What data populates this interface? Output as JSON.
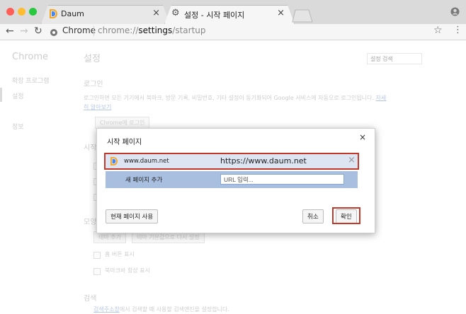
{
  "browser": {
    "tabs": [
      {
        "title": "Daum"
      },
      {
        "title": "설정 - 시작 페이지"
      }
    ],
    "tab_close": "×",
    "omnibox": {
      "chip": "Chrome",
      "url_prefix": "chrome://",
      "url_bold": "settings",
      "url_suffix": "/startup"
    }
  },
  "settings": {
    "sidebar_title": "Chrome",
    "sidebar_items": [
      "확장 프로그램",
      "설정",
      "정보"
    ],
    "page_title": "설정",
    "search_placeholder": "설정 검색",
    "login_heading": "로그인",
    "login_text": "로그인하면 모든 기기에서 북마크, 방문 기록, 비밀번호, 기타 설정이 동기화되어 Google 서비스에 자동으로 로그인됩니다.",
    "login_link_1": "자세",
    "login_link_2": "히 알아보기",
    "login_button": "Chrome에 로그인",
    "startup_heading_partial": "시작",
    "appearance_heading_partial": "모양",
    "theme_button": "테마 추가",
    "theme_reset_button": "테마 기본값으로 다시 설정",
    "home_button_label": "홈 버튼 표시",
    "bookmark_bar_label": "북마크바 항상 표시",
    "search_heading": "검색",
    "search_link": "검색주소창",
    "search_text": "에서 검색할 때 사용할 검색엔진을 설정합니다."
  },
  "dialog": {
    "title": "시작 페이지",
    "close": "×",
    "page_name": "www.daum.net",
    "page_url": "https://www.daum.net",
    "remove": "×",
    "add_page_label": "새 페이지 추가",
    "url_placeholder": "URL 입력...",
    "use_current_button": "현재 페이지 사용",
    "cancel_button": "취소",
    "ok_button": "확인"
  },
  "colors": {
    "highlight_outline": "#c0392b",
    "selected_row": "#dde5f2",
    "input_row": "#a9bfdf"
  }
}
